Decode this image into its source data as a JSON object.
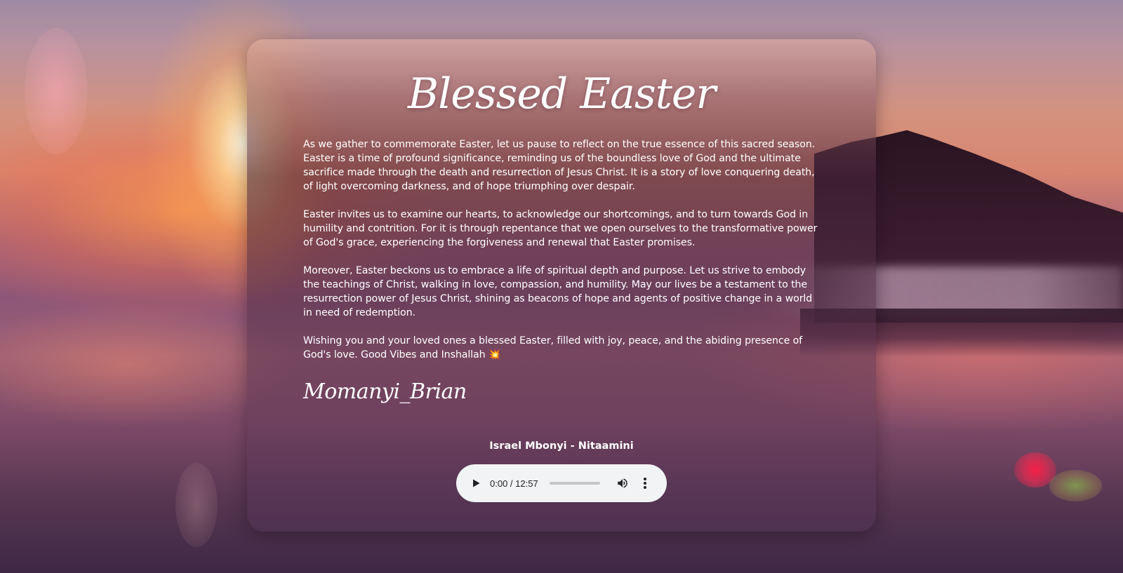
{
  "card": {
    "title": "Blessed Easter",
    "paragraphs": [
      "As we gather to commemorate Easter, let us pause to reflect on the true essence of this sacred season. Easter is a time of profound significance, reminding us of the boundless love of God and the ultimate sacrifice made through the death and resurrection of Jesus Christ. It is a story of love conquering death, of light overcoming darkness, and of hope triumphing over despair.",
      "Easter invites us to examine our hearts, to acknowledge our shortcomings, and to turn towards God in humility and contrition. For it is through repentance that we open ourselves to the transformative power of God's grace, experiencing the forgiveness and renewal that Easter promises.",
      "Moreover, Easter beckons us to embrace a life of spiritual depth and purpose. Let us strive to embody the teachings of Christ, walking in love, compassion, and humility. May our lives be a testament to the resurrection power of Jesus Christ, shining as beacons of hope and agents of positive change in a world in need of redemption.",
      "Wishing you and your loved ones a blessed Easter, filled with joy, peace, and the abiding presence of God's love. Good Vibes and Inshallah 💥"
    ],
    "signature": "Momanyi_Brian"
  },
  "song": {
    "title": "Israel Mbonyi - Nitaamini"
  },
  "audio_player": {
    "time": "0:00 / 12:57",
    "progress_fraction": 0,
    "play_icon": "play-icon",
    "volume_icon": "volume-icon",
    "more_icon": "more-options-icon"
  },
  "colors": {
    "card_text": "#ffffff",
    "player_background": "#f1f3f4",
    "player_icon": "#202124"
  }
}
